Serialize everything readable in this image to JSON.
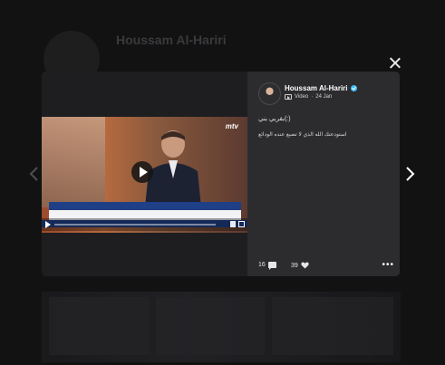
{
  "background": {
    "profile_name": "Houssam Al-Hariri",
    "profile_sub": ""
  },
  "post": {
    "author": "Houssam Al-Hariri",
    "verified": true,
    "type_label": "Video",
    "date": "24 Jan",
    "meta_separator": "·",
    "text_line1": "(:)بقربي بني",
    "text_line2": "استودعتك الله الذي لا تضيع عنده الودائع",
    "comments": "16",
    "likes": "39",
    "more_label": "•••"
  },
  "video": {
    "channel_logo": "mtv",
    "progress": 0
  },
  "icons": {
    "close": "close-icon",
    "prev": "chevron-left-icon",
    "next": "chevron-right-icon",
    "play": "play-icon",
    "comment": "comment-icon",
    "like": "heart-icon",
    "verified": "verified-badge-icon",
    "video_type": "video-icon"
  },
  "colors": {
    "verified": "#3fc1ff",
    "modal_panel": "#2c2c2f",
    "news_band": "#1f3f86"
  }
}
